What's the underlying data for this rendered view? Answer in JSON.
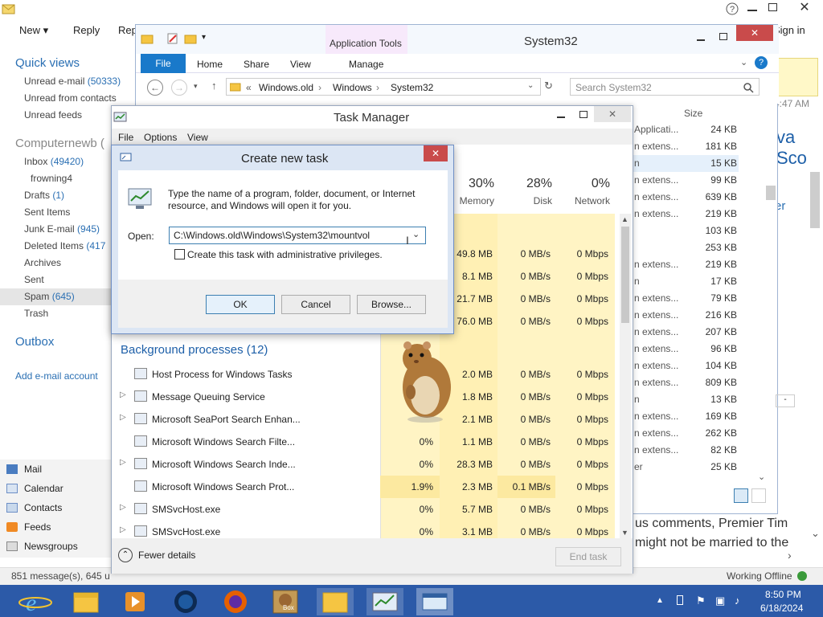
{
  "mail": {
    "toolbar": {
      "new": "New",
      "reply": "Reply",
      "reply_partial": "Rep"
    },
    "title_right": {
      "sign_in": "Sign in"
    },
    "quick_views": {
      "heading": "Quick views",
      "items": [
        {
          "label": "Unread e-mail",
          "count": "(50333)"
        },
        {
          "label": "Unread from contacts",
          "count": ""
        },
        {
          "label": "Unread feeds",
          "count": ""
        }
      ]
    },
    "account": {
      "heading": "Computernewb (",
      "items": [
        {
          "label": "Inbox",
          "count": "(49420)"
        },
        {
          "label": "frowning4",
          "count": ""
        },
        {
          "label": "Drafts",
          "count": "(1)"
        },
        {
          "label": "Sent Items",
          "count": ""
        },
        {
          "label": "Junk E-mail",
          "count": "(945)"
        },
        {
          "label": "Deleted Items",
          "count": "(417"
        },
        {
          "label": "Archives",
          "count": ""
        },
        {
          "label": "Sent",
          "count": ""
        },
        {
          "label": "Spam",
          "count": "(645)"
        },
        {
          "label": "Trash",
          "count": ""
        }
      ]
    },
    "outbox": "Outbox",
    "add_account": "Add e-mail account",
    "bottom_nav": [
      "Mail",
      "Calendar",
      "Contacts",
      "Feeds",
      "Newsgroups"
    ],
    "status_left": "851 message(s), 645 u",
    "status_right": "Working Offline",
    "preview_time": "4:47 AM",
    "preview_partial_title": "va Sco",
    "preview_er": "er",
    "preview_text_1": "us comments, Premier Tim",
    "preview_text_2": "might not be married to the"
  },
  "explorer": {
    "title": "System32",
    "app_tools": "Application Tools",
    "ribbon_tabs": [
      "File",
      "Home",
      "Share",
      "View",
      "Manage"
    ],
    "path": [
      "Windows.old",
      "Windows",
      "System32"
    ],
    "path_prefix": "«",
    "search_placeholder": "Search System32",
    "size_header": "Size",
    "files": [
      {
        "type": "Applicati...",
        "size": "24 KB"
      },
      {
        "type": "n extens...",
        "size": "181 KB"
      },
      {
        "type": "n",
        "size": "15 KB"
      },
      {
        "type": "n extens...",
        "size": "99 KB"
      },
      {
        "type": "n extens...",
        "size": "639 KB"
      },
      {
        "type": "n extens...",
        "size": "219 KB"
      },
      {
        "type": "",
        "size": "103 KB"
      },
      {
        "type": "",
        "size": "253 KB"
      },
      {
        "type": "n extens...",
        "size": "219 KB"
      },
      {
        "type": "n",
        "size": "17 KB"
      },
      {
        "type": "n extens...",
        "size": "79 KB"
      },
      {
        "type": "n extens...",
        "size": "216 KB"
      },
      {
        "type": "n extens...",
        "size": "207 KB"
      },
      {
        "type": "n extens...",
        "size": "96 KB"
      },
      {
        "type": "n extens...",
        "size": "104 KB"
      },
      {
        "type": "n extens...",
        "size": "809 KB"
      },
      {
        "type": "n",
        "size": "13 KB"
      },
      {
        "type": "n extens...",
        "size": "169 KB"
      },
      {
        "type": "n extens...",
        "size": "262 KB"
      },
      {
        "type": "n extens...",
        "size": "82 KB"
      },
      {
        "type": "er",
        "size": "25 KB"
      }
    ]
  },
  "taskmanager": {
    "title": "Task Manager",
    "menu": [
      "File",
      "Options",
      "View"
    ],
    "columns": [
      {
        "pct": "30%",
        "label": "Memory"
      },
      {
        "pct": "28%",
        "label": "Disk"
      },
      {
        "pct": "0%",
        "label": "Network"
      }
    ],
    "app_rows": [
      {
        "mem": "49.8 MB",
        "disk": "0 MB/s",
        "net": "0 Mbps"
      },
      {
        "mem": "8.1 MB",
        "disk": "0 MB/s",
        "net": "0 Mbps"
      },
      {
        "mem": "21.7 MB",
        "disk": "0 MB/s",
        "net": "0 Mbps"
      },
      {
        "mem": "76.0 MB",
        "disk": "0 MB/s",
        "net": "0 Mbps"
      }
    ],
    "bg_heading": "Background processes (12)",
    "bg_rows": [
      {
        "name": "Host Process for Windows Tasks",
        "cpu": "",
        "mem": "2.0 MB",
        "disk": "0 MB/s",
        "net": "0 Mbps",
        "expand": false
      },
      {
        "name": "Message Queuing Service",
        "cpu": "",
        "mem": "1.8 MB",
        "disk": "0 MB/s",
        "net": "0 Mbps",
        "expand": true
      },
      {
        "name": "Microsoft SeaPort Search Enhan...",
        "cpu": "",
        "mem": "2.1 MB",
        "disk": "0 MB/s",
        "net": "0 Mbps",
        "expand": true
      },
      {
        "name": "Microsoft Windows Search Filte...",
        "cpu": "0%",
        "mem": "1.1 MB",
        "disk": "0 MB/s",
        "net": "0 Mbps",
        "expand": false
      },
      {
        "name": "Microsoft Windows Search Inde...",
        "cpu": "0%",
        "mem": "28.3 MB",
        "disk": "0 MB/s",
        "net": "0 Mbps",
        "expand": true
      },
      {
        "name": "Microsoft Windows Search Prot...",
        "cpu": "1.9%",
        "mem": "2.3 MB",
        "disk": "0.1 MB/s",
        "net": "0 Mbps",
        "expand": false
      },
      {
        "name": "SMSvcHost.exe",
        "cpu": "0%",
        "mem": "5.7 MB",
        "disk": "0 MB/s",
        "net": "0 Mbps",
        "expand": true
      },
      {
        "name": "SMSvcHost.exe",
        "cpu": "0%",
        "mem": "3.1 MB",
        "disk": "0 MB/s",
        "net": "0 Mbps",
        "expand": true
      }
    ],
    "fewer_details": "Fewer details",
    "end_task": "End task"
  },
  "dialog": {
    "title": "Create new task",
    "description": "Type the name of a program, folder, document, or Internet resource, and Windows will open it for you.",
    "open_label": "Open:",
    "open_value": "C:\\Windows.old\\Windows\\System32\\mountvol",
    "admin_label": "Create this task with administrative privileges.",
    "ok": "OK",
    "cancel": "Cancel",
    "browse": "Browse..."
  },
  "taskbar": {
    "time": "8:50 PM",
    "date": "6/18/2024",
    "box_label": "Box"
  }
}
